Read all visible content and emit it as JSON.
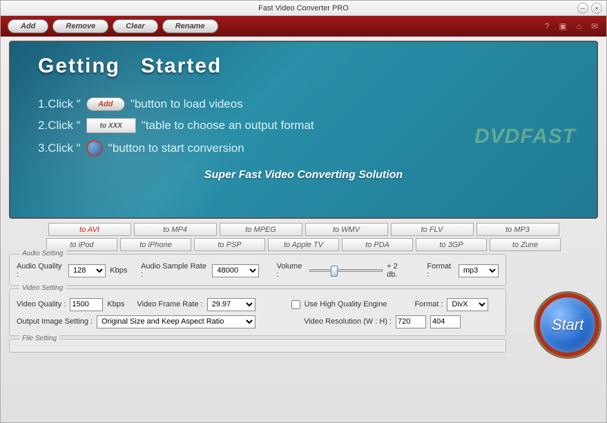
{
  "window": {
    "title": "Fast Video Converter PRO"
  },
  "toolbar": {
    "add": "Add",
    "remove": "Remove",
    "clear": "Clear",
    "rename": "Rename"
  },
  "hero": {
    "title1": "Getting",
    "title2": "Started",
    "step1_pre": "1.Click \"",
    "step1_btn": "Add",
    "step1_post": "\"button to load videos",
    "step2_pre": "2.Click \"",
    "step2_btn": "to XXX",
    "step2_post": "\"table to choose an output format",
    "step3_pre": "3.Click \"",
    "step3_post": "\"button to start conversion",
    "tagline": "Super Fast Video Converting Solution",
    "watermark": "DVDFAST"
  },
  "tabs": {
    "row1": [
      "to AVI",
      "to MP4",
      "to MPEG",
      "to WMV",
      "to FLV",
      "to MP3"
    ],
    "row2": [
      "to iPod",
      "to iPhone",
      "to PSP",
      "to Apple TV",
      "to PDA",
      "to 3GP",
      "to Zune"
    ],
    "active": "to AVI"
  },
  "audio": {
    "legend": "Audio Setting",
    "quality_label": "Audio Quality :",
    "quality_value": "128",
    "quality_unit": "Kbps",
    "sample_label": "Audio Sample Rate :",
    "sample_value": "48000",
    "volume_label": "Volume :",
    "volume_text": "+ 2 db.",
    "format_label": "Format :",
    "format_value": "mp3"
  },
  "video": {
    "legend": "Video Setting",
    "quality_label": "Video Quality :",
    "quality_value": "1500",
    "quality_unit": "Kbps",
    "frame_label": "Video Frame Rate :",
    "frame_value": "29.97",
    "hq_label": "Use High Quality Engine",
    "format_label": "Format :",
    "format_value": "DivX",
    "output_label": "Output Image Setting :",
    "output_value": "Original Size and Keep Aspect Ratio",
    "res_label": "Video Resolution (W : H) :",
    "res_w": "720",
    "res_h": "404"
  },
  "file": {
    "legend": "File Setting"
  },
  "start": {
    "label": "Start"
  }
}
